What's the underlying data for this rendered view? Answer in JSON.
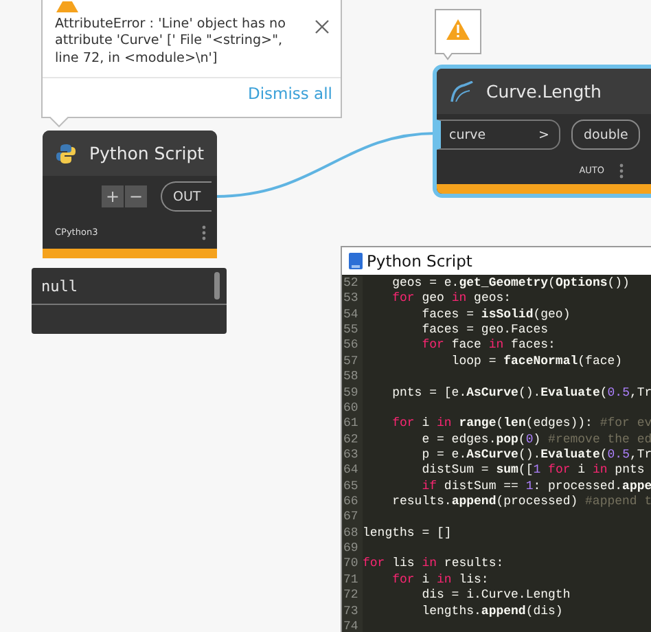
{
  "error_tooltip": {
    "message": "AttributeError : 'Line' object has no attribute 'Curve' ['  File \"<string>\", line 72, in <module>\\n']",
    "dismiss": "Dismiss all"
  },
  "nodes": [
    {
      "title": "Python Script",
      "kind": "python",
      "selected": false,
      "warning": true,
      "add": "+",
      "remove": "−",
      "output": "OUT",
      "engine": "CPython3"
    },
    {
      "title": "Curve.Length",
      "kind": "function",
      "selected": true,
      "warning": true,
      "input": "curve",
      "input_arrow": ">",
      "output": "double",
      "lacing": "AUTO"
    }
  ],
  "preview": {
    "value": "null"
  },
  "code_window": {
    "title": "Python Script",
    "lines": [
      {
        "number": "52",
        "tokens": [
          {
            "kind": "plain",
            "text": "    geos = e."
          },
          {
            "kind": "fn",
            "text": "get_Geometry"
          },
          {
            "kind": "plain",
            "text": "("
          },
          {
            "kind": "fn",
            "text": "Options"
          },
          {
            "kind": "plain",
            "text": "())"
          }
        ]
      },
      {
        "number": "53",
        "tokens": [
          {
            "kind": "kw",
            "text": "    for"
          },
          {
            "kind": "plain",
            "text": " geo "
          },
          {
            "kind": "kw",
            "text": "in"
          },
          {
            "kind": "plain",
            "text": " geos:"
          }
        ]
      },
      {
        "number": "54",
        "tokens": [
          {
            "kind": "plain",
            "text": "        faces = "
          },
          {
            "kind": "fn",
            "text": "isSolid"
          },
          {
            "kind": "plain",
            "text": "(geo)"
          }
        ]
      },
      {
        "number": "55",
        "tokens": [
          {
            "kind": "plain",
            "text": "        faces = geo.Faces"
          }
        ]
      },
      {
        "number": "56",
        "tokens": [
          {
            "kind": "kw",
            "text": "        for"
          },
          {
            "kind": "plain",
            "text": " face "
          },
          {
            "kind": "kw",
            "text": "in"
          },
          {
            "kind": "plain",
            "text": " faces:"
          }
        ]
      },
      {
        "number": "57",
        "tokens": [
          {
            "kind": "plain",
            "text": "            loop = "
          },
          {
            "kind": "fn",
            "text": "faceNormal"
          },
          {
            "kind": "plain",
            "text": "(face)"
          }
        ]
      },
      {
        "number": "58"
      },
      {
        "number": "59",
        "tokens": [
          {
            "kind": "plain",
            "text": "    pnts = [e."
          },
          {
            "kind": "fn",
            "text": "AsCurve"
          },
          {
            "kind": "plain",
            "text": "()."
          },
          {
            "kind": "fn",
            "text": "Evaluate"
          },
          {
            "kind": "plain",
            "text": "("
          },
          {
            "kind": "num",
            "text": "0.5"
          },
          {
            "kind": "plain",
            "text": ",Tr"
          }
        ]
      },
      {
        "number": "60"
      },
      {
        "number": "61",
        "tokens": [
          {
            "kind": "kw",
            "text": "    for"
          },
          {
            "kind": "plain",
            "text": " i "
          },
          {
            "kind": "kw",
            "text": "in"
          },
          {
            "kind": "fn",
            "text": " range"
          },
          {
            "kind": "plain",
            "text": "("
          },
          {
            "kind": "fn",
            "text": "len"
          },
          {
            "kind": "plain",
            "text": "(edges)): "
          },
          {
            "kind": "comment",
            "text": "#for ev"
          }
        ]
      },
      {
        "number": "62",
        "tokens": [
          {
            "kind": "plain",
            "text": "        e = edges."
          },
          {
            "kind": "fn",
            "text": "pop"
          },
          {
            "kind": "plain",
            "text": "("
          },
          {
            "kind": "num",
            "text": "0"
          },
          {
            "kind": "plain",
            "text": ") "
          },
          {
            "kind": "comment",
            "text": "#remove the ed"
          }
        ]
      },
      {
        "number": "63",
        "tokens": [
          {
            "kind": "plain",
            "text": "        p = e."
          },
          {
            "kind": "fn",
            "text": "AsCurve"
          },
          {
            "kind": "plain",
            "text": "()."
          },
          {
            "kind": "fn",
            "text": "Evaluate"
          },
          {
            "kind": "plain",
            "text": "("
          },
          {
            "kind": "num",
            "text": "0.5"
          },
          {
            "kind": "plain",
            "text": ",Tr"
          }
        ]
      },
      {
        "number": "64",
        "tokens": [
          {
            "kind": "plain",
            "text": "        distSum = "
          },
          {
            "kind": "fn",
            "text": "sum"
          },
          {
            "kind": "plain",
            "text": "(["
          },
          {
            "kind": "num",
            "text": "1"
          },
          {
            "kind": "kw",
            "text": " for"
          },
          {
            "kind": "plain",
            "text": " i "
          },
          {
            "kind": "kw",
            "text": "in"
          },
          {
            "kind": "plain",
            "text": " pnts"
          }
        ]
      },
      {
        "number": "65",
        "tokens": [
          {
            "kind": "kw",
            "text": "        if"
          },
          {
            "kind": "plain",
            "text": " distSum == "
          },
          {
            "kind": "num",
            "text": "1"
          },
          {
            "kind": "plain",
            "text": ": processed."
          },
          {
            "kind": "fn",
            "text": "appe"
          }
        ]
      },
      {
        "number": "66",
        "tokens": [
          {
            "kind": "plain",
            "text": "    results."
          },
          {
            "kind": "fn",
            "text": "append"
          },
          {
            "kind": "plain",
            "text": "(processed) "
          },
          {
            "kind": "comment",
            "text": "#append t"
          }
        ]
      },
      {
        "number": "67"
      },
      {
        "number": "68",
        "tokens": [
          {
            "kind": "plain",
            "text": "lengths = []"
          }
        ]
      },
      {
        "number": "69"
      },
      {
        "number": "70",
        "tokens": [
          {
            "kind": "kw",
            "text": "for"
          },
          {
            "kind": "plain",
            "text": " lis "
          },
          {
            "kind": "kw",
            "text": "in"
          },
          {
            "kind": "plain",
            "text": " results:"
          }
        ]
      },
      {
        "number": "71",
        "tokens": [
          {
            "kind": "kw",
            "text": "    for"
          },
          {
            "kind": "plain",
            "text": " i "
          },
          {
            "kind": "kw",
            "text": "in"
          },
          {
            "kind": "plain",
            "text": " lis:"
          }
        ]
      },
      {
        "number": "72",
        "tokens": [
          {
            "kind": "plain",
            "text": "        dis = i.Curve.Length"
          }
        ]
      },
      {
        "number": "73",
        "tokens": [
          {
            "kind": "plain",
            "text": "        lengths."
          },
          {
            "kind": "fn",
            "text": "append"
          },
          {
            "kind": "plain",
            "text": "(dis)"
          }
        ]
      },
      {
        "number": "74"
      }
    ]
  }
}
